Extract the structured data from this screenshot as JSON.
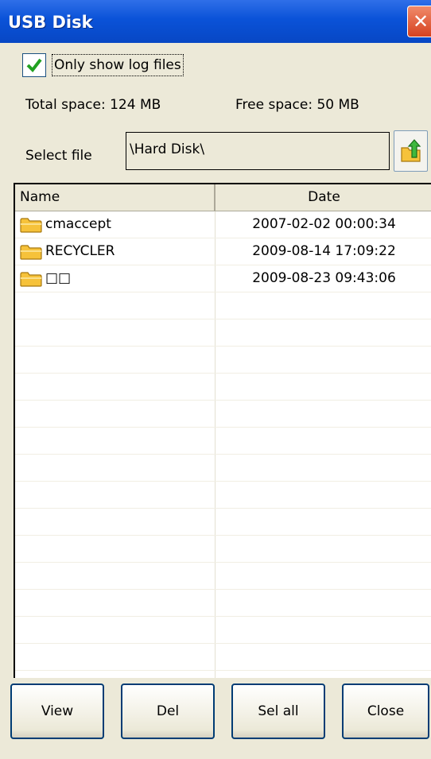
{
  "window": {
    "title": "USB Disk",
    "close_glyph": "✕"
  },
  "options": {
    "only_log_label": "Only show log files",
    "only_log_checked": true
  },
  "space": {
    "total": "Total space: 124 MB",
    "free": "Free space: 50 MB"
  },
  "path": {
    "label": "Select file",
    "value": "\\Hard Disk\\",
    "up_icon": "folder-up-icon"
  },
  "list": {
    "columns": [
      "Name",
      "Date"
    ],
    "rows": [
      {
        "name": "cmaccept",
        "date": "2007-02-02 00:00:34",
        "icon": "folder-icon"
      },
      {
        "name": "RECYCLER",
        "date": "2009-08-14 17:09:22",
        "icon": "folder-icon"
      },
      {
        "name": "□□",
        "date": "2009-08-23 09:43:06",
        "icon": "folder-icon"
      }
    ]
  },
  "buttons": {
    "view": "View",
    "del": "Del",
    "sel_all": "Sel all",
    "close": "Close"
  },
  "colors": {
    "titlebar": "#0a52d8",
    "window_bg": "#ece9d8",
    "check": "#21a121",
    "folder": "#f6c23a"
  }
}
